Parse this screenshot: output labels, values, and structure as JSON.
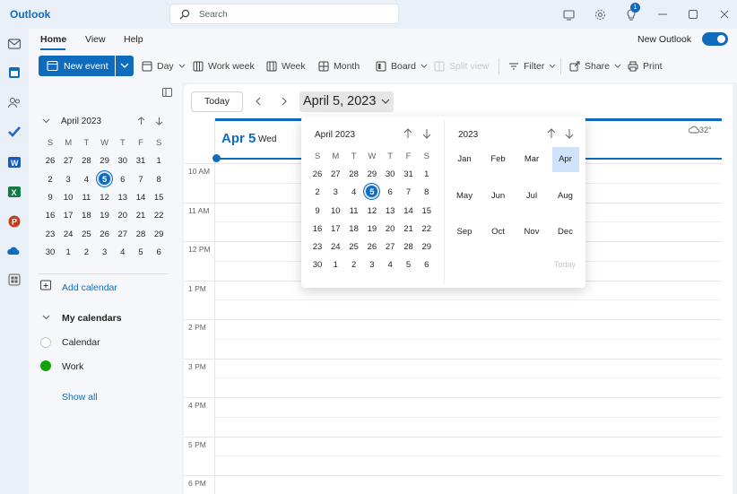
{
  "app": {
    "title": "Outlook"
  },
  "search": {
    "placeholder": "Search"
  },
  "titlebar": {
    "notification_count": "1"
  },
  "ribbon": {
    "tabs": [
      "Home",
      "View",
      "Help"
    ],
    "new_outlook_label": "New Outlook",
    "new_outlook_on": true,
    "new_event_label": "New event",
    "buttons": {
      "day": "Day",
      "work_week": "Work week",
      "week": "Week",
      "month": "Month",
      "board": "Board",
      "split_view": "Split view",
      "filter": "Filter",
      "share": "Share",
      "print": "Print"
    }
  },
  "sidebar": {
    "mini_calendar": {
      "title": "April 2023",
      "weekday_headers": [
        "S",
        "M",
        "T",
        "W",
        "T",
        "F",
        "S"
      ],
      "weeks": [
        [
          "26",
          "27",
          "28",
          "29",
          "30",
          "31",
          "1"
        ],
        [
          "2",
          "3",
          "4",
          "5",
          "6",
          "7",
          "8"
        ],
        [
          "9",
          "10",
          "11",
          "12",
          "13",
          "14",
          "15"
        ],
        [
          "16",
          "17",
          "18",
          "19",
          "20",
          "21",
          "22"
        ],
        [
          "23",
          "24",
          "25",
          "26",
          "27",
          "28",
          "29"
        ],
        [
          "30",
          "1",
          "2",
          "3",
          "4",
          "5",
          "6"
        ]
      ],
      "selected_day": "5"
    },
    "add_calendar_label": "Add calendar",
    "my_calendars_label": "My calendars",
    "calendars": [
      {
        "name": "Calendar",
        "color": "#ffffff"
      },
      {
        "name": "Work",
        "color": "#13a10e"
      }
    ],
    "show_all_label": "Show all"
  },
  "main": {
    "today_label": "Today",
    "date_title": "April 5, 2023",
    "day_number": "Apr 5",
    "day_name": "Wed",
    "weather": "32°",
    "hours": [
      "10 AM",
      "11 AM",
      "12 PM",
      "1 PM",
      "2 PM",
      "3 PM",
      "4 PM",
      "5 PM",
      "6 PM"
    ]
  },
  "date_picker": {
    "day_view": {
      "title": "April 2023",
      "weekday_headers": [
        "S",
        "M",
        "T",
        "W",
        "T",
        "F",
        "S"
      ],
      "weeks": [
        [
          "26",
          "27",
          "28",
          "29",
          "30",
          "31",
          "1"
        ],
        [
          "2",
          "3",
          "4",
          "5",
          "6",
          "7",
          "8"
        ],
        [
          "9",
          "10",
          "11",
          "12",
          "13",
          "14",
          "15"
        ],
        [
          "16",
          "17",
          "18",
          "19",
          "20",
          "21",
          "22"
        ],
        [
          "23",
          "24",
          "25",
          "26",
          "27",
          "28",
          "29"
        ],
        [
          "30",
          "1",
          "2",
          "3",
          "4",
          "5",
          "6"
        ]
      ],
      "selected_day": "5"
    },
    "month_view": {
      "year": "2023",
      "months": [
        "Jan",
        "Feb",
        "Mar",
        "Apr",
        "May",
        "Jun",
        "Jul",
        "Aug",
        "Sep",
        "Oct",
        "Nov",
        "Dec"
      ],
      "selected_month": "Apr",
      "today_label": "Today"
    }
  },
  "colors": {
    "accent": "#0f6cbd",
    "work_calendar": "#13a10e"
  }
}
